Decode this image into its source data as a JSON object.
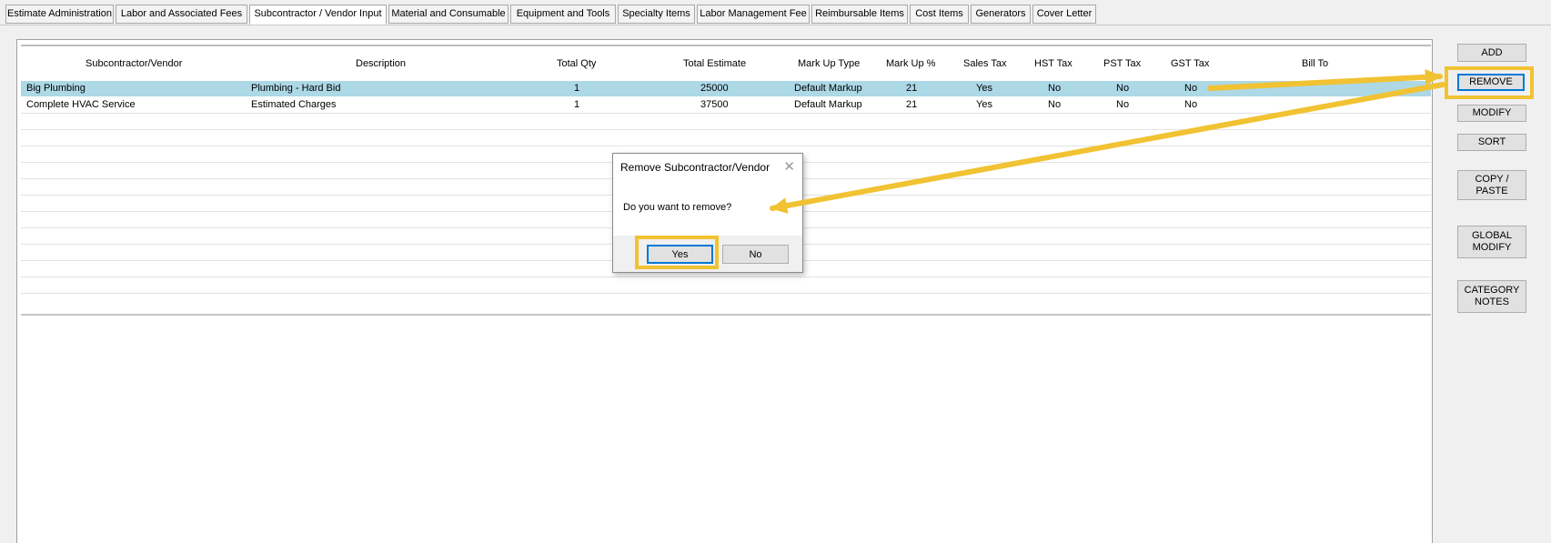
{
  "tabs": [
    {
      "label": "Estimate Administration"
    },
    {
      "label": "Labor and Associated Fees"
    },
    {
      "label": "Subcontractor / Vendor Input"
    },
    {
      "label": "Material and Consumable"
    },
    {
      "label": "Equipment and Tools"
    },
    {
      "label": "Specialty Items"
    },
    {
      "label": "Labor Management Fee"
    },
    {
      "label": "Reimbursable Items"
    },
    {
      "label": "Cost Items"
    },
    {
      "label": "Generators"
    },
    {
      "label": "Cover Letter"
    }
  ],
  "active_tab": "Subcontractor / Vendor Input",
  "grid": {
    "columns": [
      "Subcontractor/Vendor",
      "Description",
      "Total Qty",
      "Total Estimate",
      "Mark Up Type",
      "Mark Up %",
      "Sales Tax",
      "HST Tax",
      "PST Tax",
      "GST Tax",
      "Bill To"
    ],
    "rows": [
      {
        "vendor": "Big Plumbing",
        "description": "Plumbing - Hard Bid",
        "qty": "1",
        "estimate": "25000",
        "markup_type": "Default Markup",
        "markup_pct": "21",
        "sales_tax": "Yes",
        "hst": "No",
        "pst": "No",
        "gst": "No",
        "bill_to": "",
        "selected": true
      },
      {
        "vendor": "Complete HVAC Service",
        "description": "Estimated Charges",
        "qty": "1",
        "estimate": "37500",
        "markup_type": "Default Markup",
        "markup_pct": "21",
        "sales_tax": "Yes",
        "hst": "No",
        "pst": "No",
        "gst": "No",
        "bill_to": "",
        "selected": false
      }
    ]
  },
  "side_buttons": {
    "add": "ADD",
    "remove": "REMOVE",
    "modify": "MODIFY",
    "sort": "SORT",
    "copy_paste": "COPY /\nPASTE",
    "global_modify": "GLOBAL\nMODIFY",
    "category_notes": "CATEGORY\nNOTES"
  },
  "dialog": {
    "title": "Remove Subcontractor/Vendor",
    "close_glyph": "✕",
    "message": "Do you want to remove?",
    "yes": "Yes",
    "no": "No"
  },
  "highlight_color": "#f1c232",
  "selection_color": "#add8e6",
  "focus_color": "#0078d7"
}
